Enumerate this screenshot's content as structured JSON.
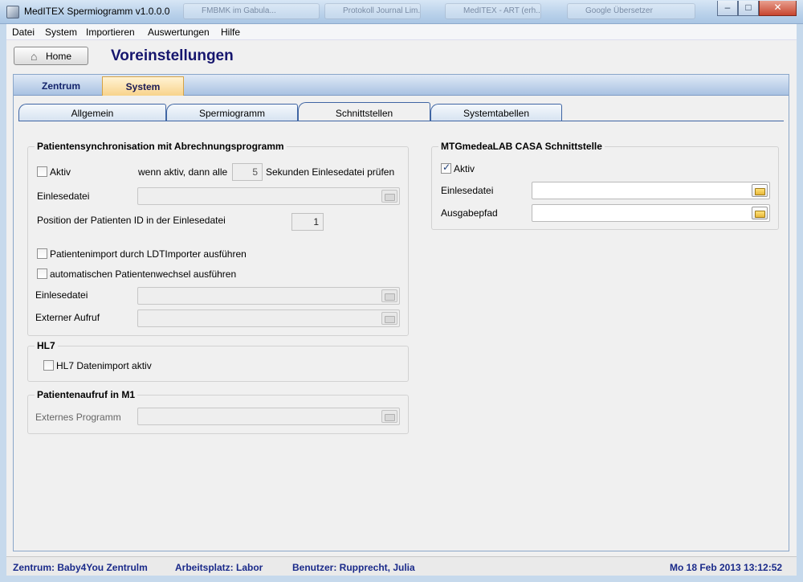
{
  "window": {
    "title": "MedITEX Spermiogramm v1.0.0.0",
    "background_taskbar": [
      "FMBMK im Gabula...",
      "Protokoll Journal Lim...",
      "MedITEX - ART (erh...",
      "Google Übersetzer"
    ],
    "controls": {
      "minimize": "–",
      "maximize": "□",
      "close": "✕"
    }
  },
  "menu": [
    "Datei",
    "System",
    "Importieren",
    "Auswertungen",
    "Hilfe"
  ],
  "toolbar": {
    "home_label": "Home"
  },
  "page_title": "Voreinstellungen",
  "main_tabs": [
    {
      "label": "Zentrum",
      "active": false
    },
    {
      "label": "System",
      "active": true
    }
  ],
  "sub_tabs": [
    {
      "label": "Allgemein",
      "active": false
    },
    {
      "label": "Spermiogramm",
      "active": false
    },
    {
      "label": "Schnittstellen",
      "active": true
    },
    {
      "label": "Systemtabellen",
      "active": false
    }
  ],
  "patient_sync": {
    "title": "Patientensynchronisation mit Abrechnungsprogramm",
    "aktiv_label": "Aktiv",
    "aktiv_checked": false,
    "interval_prefix": "wenn aktiv, dann alle",
    "interval_value": "5",
    "interval_suffix": "Sekunden Einlesedatei prüfen",
    "einlesedatei_label": "Einlesedatei",
    "einlesedatei_value": "",
    "position_label": "Position der Patienten ID in der Einlesedatei",
    "position_value": "1",
    "ldt_label": "Patientenimport durch LDTImporter ausführen",
    "ldt_checked": false,
    "auto_label": "automatischen Patientenwechsel ausführen",
    "auto_checked": false,
    "einlesedatei2_label": "Einlesedatei",
    "einlesedatei2_value": "",
    "externer_aufruf_label": "Externer Aufruf",
    "externer_aufruf_value": ""
  },
  "hl7": {
    "title": "HL7",
    "import_label": "HL7 Datenimport aktiv",
    "import_checked": false
  },
  "patientenaufruf": {
    "title": "Patientenaufruf in M1",
    "programm_label": "Externes Programm",
    "programm_value": ""
  },
  "casa": {
    "title": "MTGmedeaLAB CASA Schnittstelle",
    "aktiv_label": "Aktiv",
    "aktiv_checked": true,
    "einlesedatei_label": "Einlesedatei",
    "einlesedatei_value": "",
    "ausgabepfad_label": "Ausgabepfad",
    "ausgabepfad_value": ""
  },
  "status": {
    "zentrum": "Zentrum: Baby4You Zentrulm",
    "arbeitsplatz": "Arbeitsplatz: Labor",
    "benutzer": "Benutzer: Rupprecht, Julia",
    "datetime": "Mo 18 Feb 2013 13:12:52"
  },
  "colors": {
    "accent": "#16166e",
    "active_tab": "#f8d38b",
    "status_text": "#1a2a8a"
  }
}
